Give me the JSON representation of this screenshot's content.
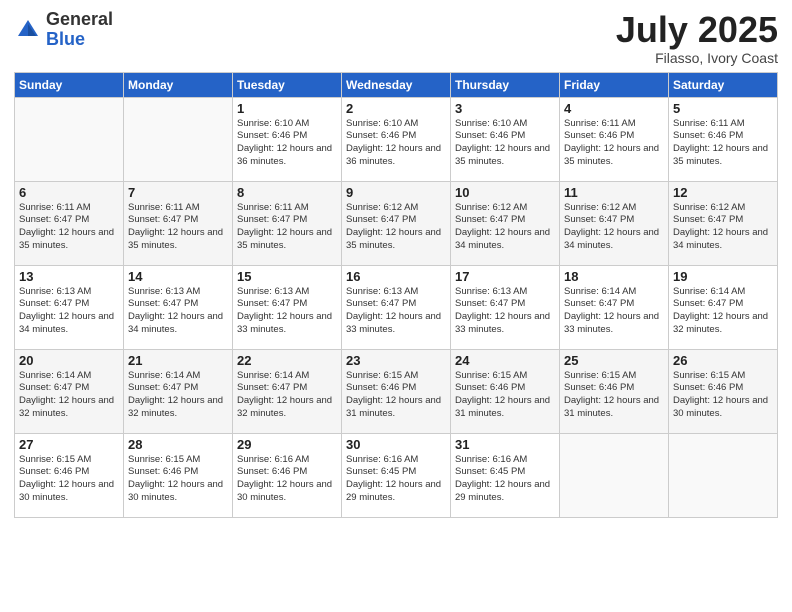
{
  "header": {
    "logo_general": "General",
    "logo_blue": "Blue",
    "month": "July 2025",
    "location": "Filasso, Ivory Coast"
  },
  "days_header": [
    "Sunday",
    "Monday",
    "Tuesday",
    "Wednesday",
    "Thursday",
    "Friday",
    "Saturday"
  ],
  "weeks": [
    [
      {
        "day": "",
        "info": ""
      },
      {
        "day": "",
        "info": ""
      },
      {
        "day": "1",
        "info": "Sunrise: 6:10 AM\nSunset: 6:46 PM\nDaylight: 12 hours and 36 minutes."
      },
      {
        "day": "2",
        "info": "Sunrise: 6:10 AM\nSunset: 6:46 PM\nDaylight: 12 hours and 36 minutes."
      },
      {
        "day": "3",
        "info": "Sunrise: 6:10 AM\nSunset: 6:46 PM\nDaylight: 12 hours and 35 minutes."
      },
      {
        "day": "4",
        "info": "Sunrise: 6:11 AM\nSunset: 6:46 PM\nDaylight: 12 hours and 35 minutes."
      },
      {
        "day": "5",
        "info": "Sunrise: 6:11 AM\nSunset: 6:46 PM\nDaylight: 12 hours and 35 minutes."
      }
    ],
    [
      {
        "day": "6",
        "info": "Sunrise: 6:11 AM\nSunset: 6:47 PM\nDaylight: 12 hours and 35 minutes."
      },
      {
        "day": "7",
        "info": "Sunrise: 6:11 AM\nSunset: 6:47 PM\nDaylight: 12 hours and 35 minutes."
      },
      {
        "day": "8",
        "info": "Sunrise: 6:11 AM\nSunset: 6:47 PM\nDaylight: 12 hours and 35 minutes."
      },
      {
        "day": "9",
        "info": "Sunrise: 6:12 AM\nSunset: 6:47 PM\nDaylight: 12 hours and 35 minutes."
      },
      {
        "day": "10",
        "info": "Sunrise: 6:12 AM\nSunset: 6:47 PM\nDaylight: 12 hours and 34 minutes."
      },
      {
        "day": "11",
        "info": "Sunrise: 6:12 AM\nSunset: 6:47 PM\nDaylight: 12 hours and 34 minutes."
      },
      {
        "day": "12",
        "info": "Sunrise: 6:12 AM\nSunset: 6:47 PM\nDaylight: 12 hours and 34 minutes."
      }
    ],
    [
      {
        "day": "13",
        "info": "Sunrise: 6:13 AM\nSunset: 6:47 PM\nDaylight: 12 hours and 34 minutes."
      },
      {
        "day": "14",
        "info": "Sunrise: 6:13 AM\nSunset: 6:47 PM\nDaylight: 12 hours and 34 minutes."
      },
      {
        "day": "15",
        "info": "Sunrise: 6:13 AM\nSunset: 6:47 PM\nDaylight: 12 hours and 33 minutes."
      },
      {
        "day": "16",
        "info": "Sunrise: 6:13 AM\nSunset: 6:47 PM\nDaylight: 12 hours and 33 minutes."
      },
      {
        "day": "17",
        "info": "Sunrise: 6:13 AM\nSunset: 6:47 PM\nDaylight: 12 hours and 33 minutes."
      },
      {
        "day": "18",
        "info": "Sunrise: 6:14 AM\nSunset: 6:47 PM\nDaylight: 12 hours and 33 minutes."
      },
      {
        "day": "19",
        "info": "Sunrise: 6:14 AM\nSunset: 6:47 PM\nDaylight: 12 hours and 32 minutes."
      }
    ],
    [
      {
        "day": "20",
        "info": "Sunrise: 6:14 AM\nSunset: 6:47 PM\nDaylight: 12 hours and 32 minutes."
      },
      {
        "day": "21",
        "info": "Sunrise: 6:14 AM\nSunset: 6:47 PM\nDaylight: 12 hours and 32 minutes."
      },
      {
        "day": "22",
        "info": "Sunrise: 6:14 AM\nSunset: 6:47 PM\nDaylight: 12 hours and 32 minutes."
      },
      {
        "day": "23",
        "info": "Sunrise: 6:15 AM\nSunset: 6:46 PM\nDaylight: 12 hours and 31 minutes."
      },
      {
        "day": "24",
        "info": "Sunrise: 6:15 AM\nSunset: 6:46 PM\nDaylight: 12 hours and 31 minutes."
      },
      {
        "day": "25",
        "info": "Sunrise: 6:15 AM\nSunset: 6:46 PM\nDaylight: 12 hours and 31 minutes."
      },
      {
        "day": "26",
        "info": "Sunrise: 6:15 AM\nSunset: 6:46 PM\nDaylight: 12 hours and 30 minutes."
      }
    ],
    [
      {
        "day": "27",
        "info": "Sunrise: 6:15 AM\nSunset: 6:46 PM\nDaylight: 12 hours and 30 minutes."
      },
      {
        "day": "28",
        "info": "Sunrise: 6:15 AM\nSunset: 6:46 PM\nDaylight: 12 hours and 30 minutes."
      },
      {
        "day": "29",
        "info": "Sunrise: 6:16 AM\nSunset: 6:46 PM\nDaylight: 12 hours and 30 minutes."
      },
      {
        "day": "30",
        "info": "Sunrise: 6:16 AM\nSunset: 6:45 PM\nDaylight: 12 hours and 29 minutes."
      },
      {
        "day": "31",
        "info": "Sunrise: 6:16 AM\nSunset: 6:45 PM\nDaylight: 12 hours and 29 minutes."
      },
      {
        "day": "",
        "info": ""
      },
      {
        "day": "",
        "info": ""
      }
    ]
  ]
}
